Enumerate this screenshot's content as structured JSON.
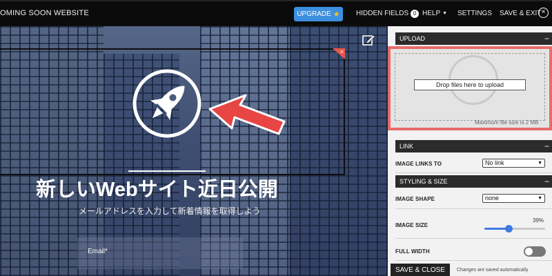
{
  "topbar": {
    "title": "OMING SOON WEBSITE",
    "upgrade_label": "UPGRADE",
    "hidden_fields_label": "HIDDEN FIELDS",
    "hidden_fields_count": "0",
    "help_label": "HELP",
    "settings_label": "SETTINGS",
    "save_exit_label": "SAVE & EXIT"
  },
  "preview": {
    "headline": "新しいWebサイト近日公開",
    "subline": "メールアドレスを入力して新着情報を取得しよう",
    "email_label": "Email*",
    "selection_close": "×"
  },
  "panel": {
    "upload": {
      "header": "UPLOAD",
      "drop_label": "Drop files here to upload",
      "max_note": "Maximum file size is 2 MB"
    },
    "link": {
      "header": "LINK",
      "image_links_to_label": "IMAGE LINKS TO",
      "image_links_to_value": "No link"
    },
    "styling": {
      "header": "STYLING & SIZE",
      "image_shape_label": "IMAGE SHAPE",
      "image_shape_value": "none",
      "image_size_label": "IMAGE SIZE",
      "image_size_value": "39%",
      "image_size_fraction": 0.39,
      "full_width_label": "FULL WIDTH",
      "full_width_on": false
    },
    "footer": {
      "save_close_label": "SAVE & CLOSE",
      "saved_note": "Changes are saved automatically"
    },
    "collapse_symbol": "−"
  },
  "colors": {
    "accent": "#3d8fe0",
    "highlight": "#e86b6b",
    "arrow": "#e84545"
  },
  "icons": [
    "star-icon",
    "chevron-down-icon",
    "close-icon",
    "edit-icon",
    "rocket-icon",
    "arrow-icon",
    "collapse-icon"
  ]
}
